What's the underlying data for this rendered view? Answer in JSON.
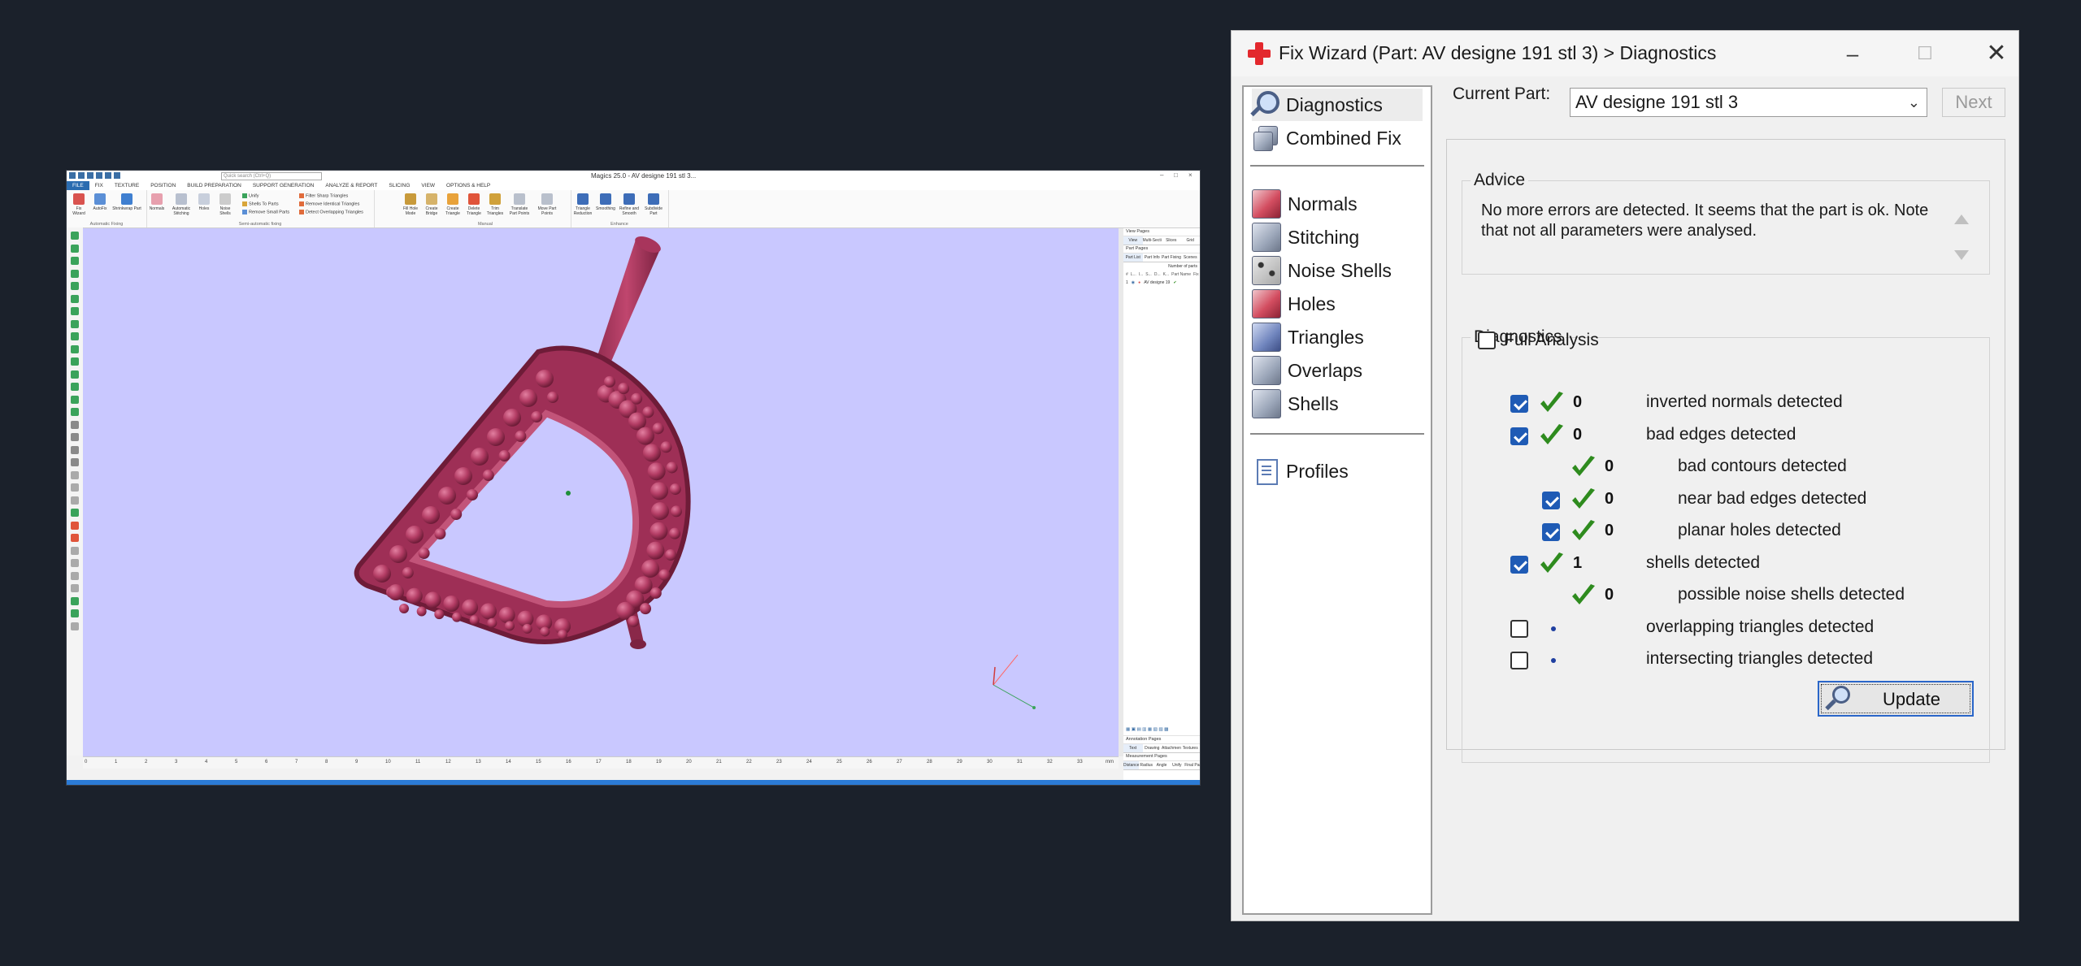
{
  "magics": {
    "window_title": "Magics 25.0 - AV designe 191 stl 3...",
    "search_placeholder": "Quick search (Ctrl+Q)",
    "menu": [
      "FILE",
      "FIX",
      "TEXTURE",
      "POSITION",
      "BUILD PREPARATION",
      "SUPPORT GENERATION",
      "ANALYZE & REPORT",
      "SLICING",
      "VIEW",
      "OPTIONS & HELP"
    ],
    "ribbon_groups": {
      "automatic_fixing": {
        "label": "Automatic Fixing",
        "buttons": [
          "Fix Wizard",
          "AutoFix",
          "Shrinkwrap Part"
        ]
      },
      "semi_automatic_fixing": {
        "label": "Semi-automatic fixing",
        "buttons": [
          "Normals",
          "Automatic Stitching",
          "Holes",
          "Noise Shells"
        ],
        "small": [
          "Unify",
          "Shells To Parts",
          "Remove Small Parts"
        ]
      },
      "triangles": {
        "small": [
          "Filter Sharp Triangles",
          "Remove Identical Triangles",
          "Detect Overlapping Triangles"
        ]
      },
      "manual": {
        "label": "Manual",
        "buttons": [
          "Fill Hole Mode",
          "Create Bridge",
          "Create Triangle",
          "Delete Triangle",
          "Trim Triangles",
          "Translate Part Points",
          "Move Part Points"
        ]
      },
      "enhance": {
        "label": "Enhance",
        "buttons": [
          "Triangle Reduction",
          "Smoothing",
          "Refine and Smooth",
          "Subdivide Part"
        ]
      }
    },
    "right_pane": {
      "view_pages": "View Pages",
      "view_tabs": [
        "View",
        "Multi-Section",
        "Slices",
        "Grid"
      ],
      "part_pages": "Part Pages",
      "part_tabs": [
        "Part List",
        "Part Info",
        "Part Fixing Info",
        "Scenes"
      ],
      "part_count_label": "Number of parts",
      "part_columns": [
        "#",
        "L...",
        "I...",
        "S...",
        "D...",
        "K...",
        "Part Name",
        "Fix Info"
      ],
      "part_row": {
        "index": "1",
        "name": "AV designe 19",
        "status": "✔"
      },
      "annotation_pages": "Annotation Pages",
      "annotation_tabs": [
        "Text",
        "Drawing",
        "Attachments",
        "Textures"
      ],
      "measurement_pages": "Measurement Pages",
      "measurement_tabs": [
        "Distance",
        "Radius",
        "Angle",
        "Unify",
        "Final Part"
      ]
    },
    "ruler": {
      "ticks": [
        "0",
        "1",
        "2",
        "3",
        "4",
        "5",
        "6",
        "7",
        "8",
        "9",
        "10",
        "11",
        "12",
        "13",
        "14",
        "15",
        "16",
        "17",
        "18",
        "19",
        "20",
        "21",
        "22",
        "23",
        "24",
        "25",
        "26",
        "27",
        "28",
        "29",
        "30",
        "31",
        "32",
        "33"
      ],
      "unit": "mm"
    },
    "colors": {
      "viewport": "#c9c8ff",
      "part": "#b33c64",
      "accent": "#2b6cb0"
    }
  },
  "wizard": {
    "title": "Fix Wizard (Part: AV designe 191 stl 3) > Diagnostics",
    "nav": [
      {
        "label": "Diagnostics",
        "icon": "magnifier-icon",
        "selected": true
      },
      {
        "label": "Combined Fix",
        "icon": "combined-fix-icon"
      },
      {
        "label": "Normals",
        "icon": "normals-cube-icon"
      },
      {
        "label": "Stitching",
        "icon": "stitching-cube-icon"
      },
      {
        "label": "Noise Shells",
        "icon": "noise-shells-cube-icon"
      },
      {
        "label": "Holes",
        "icon": "holes-cube-icon"
      },
      {
        "label": "Triangles",
        "icon": "triangles-cube-icon"
      },
      {
        "label": "Overlaps",
        "icon": "overlaps-cube-icon"
      },
      {
        "label": "Shells",
        "icon": "shells-cube-icon"
      },
      {
        "label": "Profiles",
        "icon": "profiles-document-icon"
      }
    ],
    "current_part_label": "Current Part:",
    "current_part_value": "AV designe 191 stl 3",
    "next_label": "Next",
    "advice": {
      "legend": "Advice",
      "text": "No more errors are detected. It seems that the part is ok. Note that not all parameters were analysed."
    },
    "diagnostics": {
      "legend": "Diagnostics",
      "full_analysis_label": "Full Analysis",
      "full_analysis_checked": false,
      "rows": [
        {
          "label": "inverted normals detected",
          "value": "0",
          "checked": true,
          "status": "ok",
          "indent": 0
        },
        {
          "label": "bad edges detected",
          "value": "0",
          "checked": true,
          "status": "ok",
          "indent": 0
        },
        {
          "label": "bad contours detected",
          "value": "0",
          "checked": null,
          "status": "ok",
          "indent": 1
        },
        {
          "label": "near bad edges detected",
          "value": "0",
          "checked": true,
          "status": "ok",
          "indent": 1
        },
        {
          "label": "planar holes detected",
          "value": "0",
          "checked": true,
          "status": "ok",
          "indent": 1
        },
        {
          "label": "shells detected",
          "value": "1",
          "checked": true,
          "status": "ok",
          "indent": 0
        },
        {
          "label": "possible noise shells detected",
          "value": "0",
          "checked": null,
          "status": "ok",
          "indent": 1
        },
        {
          "label": "overlapping triangles detected",
          "value": "",
          "checked": false,
          "status": "not-run",
          "indent": 0
        },
        {
          "label": "intersecting triangles detected",
          "value": "",
          "checked": false,
          "status": "not-run",
          "indent": 0
        }
      ]
    },
    "update_label": "Update",
    "colors": {
      "ok_tick": "#2e8b1e",
      "checkbox": "#1f5bb5",
      "title_cross": "#e3282d"
    }
  }
}
